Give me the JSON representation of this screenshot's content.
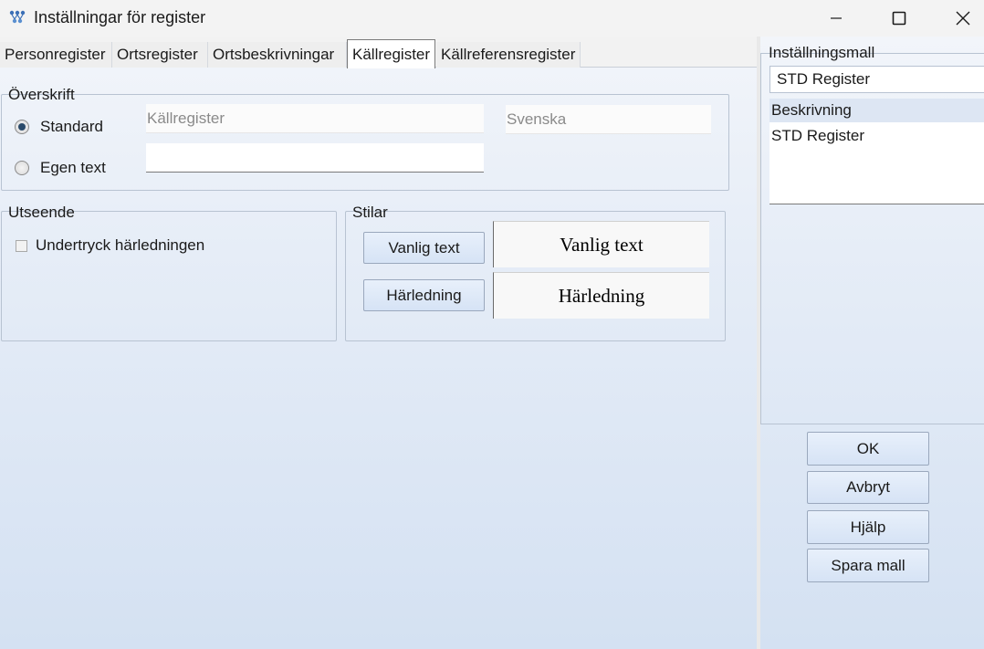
{
  "window": {
    "title": "Inställningar för register",
    "minimize_icon": "minimize-icon",
    "maximize_icon": "maximize-icon",
    "close_icon": "close-icon"
  },
  "tabs": [
    {
      "label": "Personregister",
      "active": false
    },
    {
      "label": "Ortsregister",
      "active": false
    },
    {
      "label": "Ortsbeskrivningar",
      "active": false
    },
    {
      "label": "Källregister",
      "active": true
    },
    {
      "label": "Källreferensregister",
      "active": false
    }
  ],
  "heading_group": {
    "title": "Överskrift",
    "standard_label": "Standard",
    "standard_checked": true,
    "standard_value": "Källregister",
    "language_value": "Svenska",
    "custom_label": "Egen text",
    "custom_checked": false,
    "custom_value": ""
  },
  "appearance_group": {
    "title": "Utseende",
    "suppress_label": "Undertryck härledningen",
    "suppress_checked": false
  },
  "styles_group": {
    "title": "Stilar",
    "normal_button": "Vanlig text",
    "normal_preview": "Vanlig text",
    "derivation_button": "Härledning",
    "derivation_preview": "Härledning"
  },
  "template_panel": {
    "title": "Inställningsmall",
    "selected": "STD Register",
    "description_header": "Beskrivning",
    "description": "STD Register"
  },
  "actions": {
    "ok": "OK",
    "cancel": "Avbryt",
    "help": "Hjälp",
    "save_template": "Spara mall"
  }
}
